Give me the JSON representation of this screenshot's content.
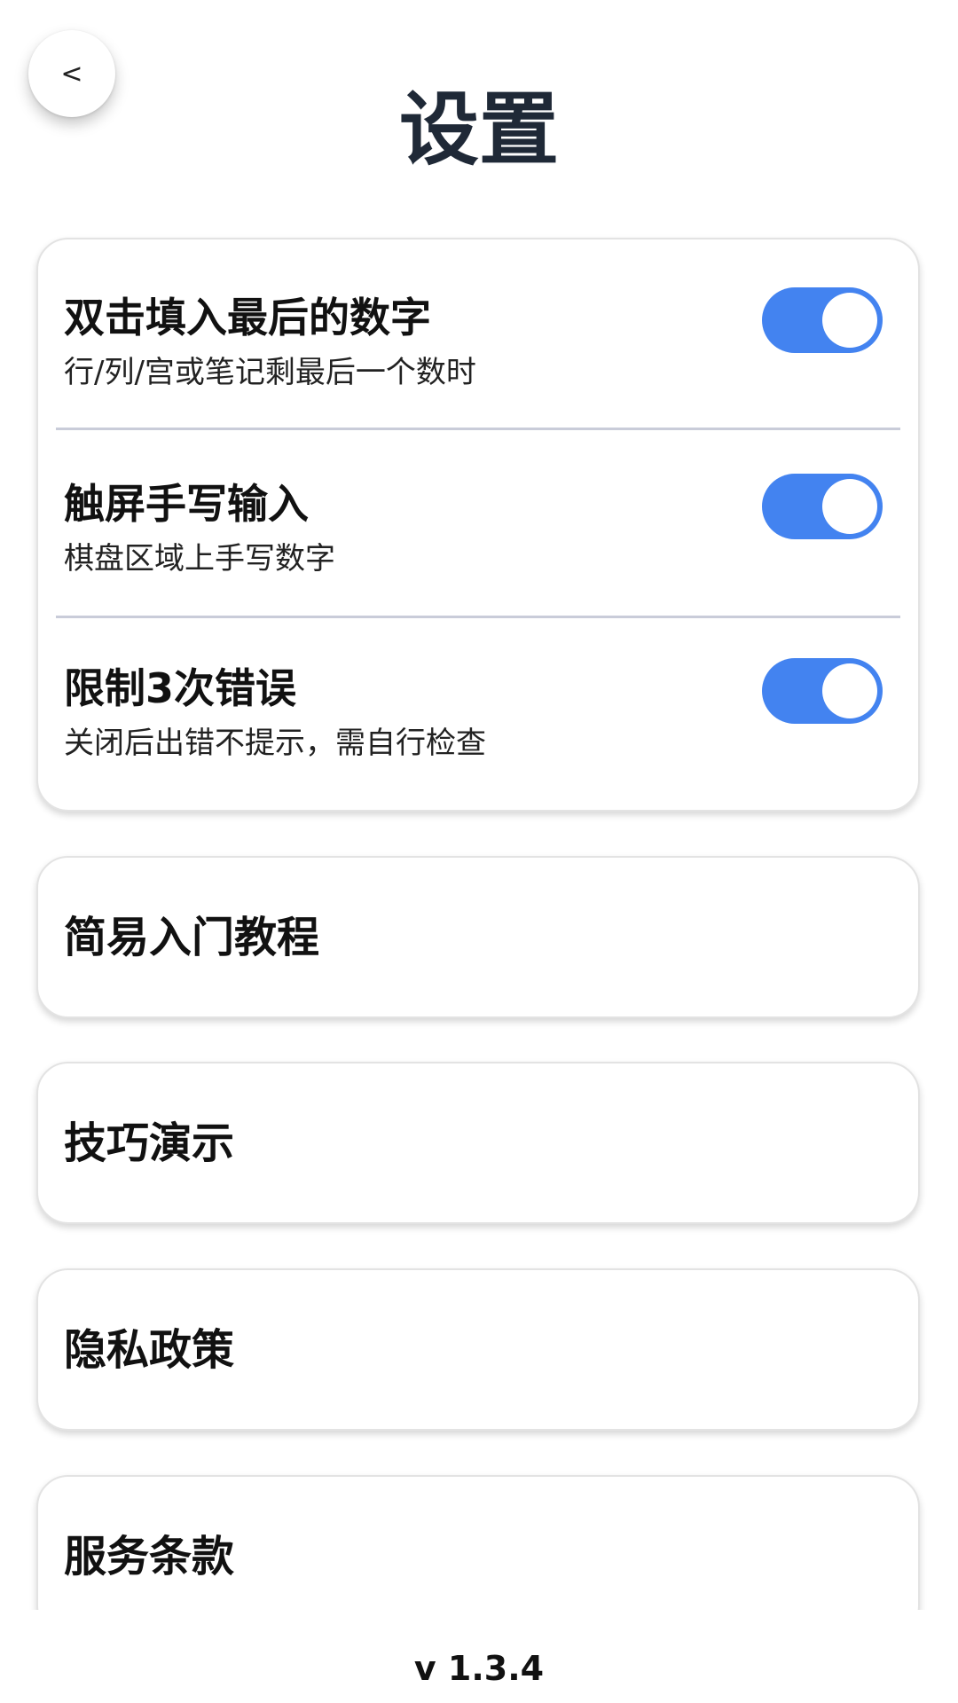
{
  "header": {
    "back_label": "<",
    "title": "设置"
  },
  "settings": [
    {
      "title": "双击填入最后的数字",
      "subtitle": "行/列/宫或笔记剩最后一个数时",
      "enabled": true
    },
    {
      "title": "触屏手写输入",
      "subtitle": "棋盘区域上手写数字",
      "enabled": true
    },
    {
      "title": "限制3次错误",
      "subtitle": "关闭后出错不提示，需自行检查",
      "enabled": true
    }
  ],
  "links": [
    {
      "label": "简易入门教程"
    },
    {
      "label": "技巧演示"
    },
    {
      "label": "隐私政策"
    },
    {
      "label": "服务条款"
    }
  ],
  "footer": {
    "version": "v 1.3.4"
  },
  "colors": {
    "accent": "#4383f0",
    "title": "#1f2937",
    "divider": "#c9ccd9"
  }
}
